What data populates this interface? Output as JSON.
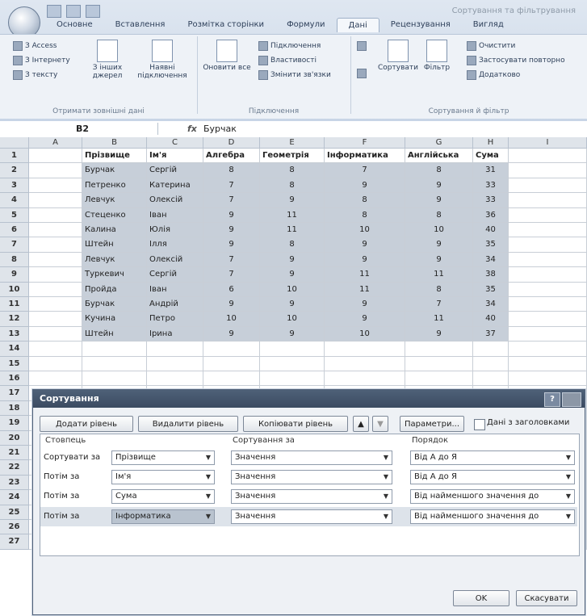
{
  "ribbon": {
    "window_title": "Сортування та фільтрування",
    "tabs": [
      "Основне",
      "Вставлення",
      "Розмітка сторінки",
      "Формули",
      "Дані",
      "Рецензування",
      "Вигляд"
    ],
    "active_tab": 4,
    "ext_data": [
      "З Access",
      "З Інтернету",
      "З тексту"
    ],
    "ext_other": "З інших джерел",
    "existing_conn": "Наявні підключення",
    "ext_group": "Отримати зовнішні дані",
    "refresh": "Оновити все",
    "conn_items": [
      "Підключення",
      "Властивості",
      "Змінити зв'язки"
    ],
    "conn_group": "Підключення",
    "sort_label": "Сортувати",
    "filter_label": "Фільтр",
    "filter_items": [
      "Очистити",
      "Застосувати повторно",
      "Додатково"
    ],
    "sort_group": "Сортування й фільтр"
  },
  "formula_bar": {
    "cell": "B2",
    "fx": "fx",
    "value": "Бурчак"
  },
  "sheet": {
    "columns": [
      "A",
      "B",
      "C",
      "D",
      "E",
      "F",
      "G",
      "H",
      "I"
    ],
    "header_row": [
      "Прізвище",
      "Ім'я",
      "Алгебра",
      "Геометрія",
      "Інформатика",
      "Англійська",
      "Сума"
    ],
    "rows": [
      [
        "Бурчак",
        "Сергій",
        "8",
        "8",
        "7",
        "8",
        "31"
      ],
      [
        "Петренко",
        "Катерина",
        "7",
        "8",
        "9",
        "9",
        "33"
      ],
      [
        "Левчук",
        "Олексій",
        "7",
        "9",
        "8",
        "9",
        "33"
      ],
      [
        "Стеценко",
        "Іван",
        "9",
        "11",
        "8",
        "8",
        "36"
      ],
      [
        "Калина",
        "Юлія",
        "9",
        "11",
        "10",
        "10",
        "40"
      ],
      [
        "Штейн",
        "Ілля",
        "9",
        "8",
        "9",
        "9",
        "35"
      ],
      [
        "Левчук",
        "Олексій",
        "7",
        "9",
        "9",
        "9",
        "34"
      ],
      [
        "Туркевич",
        "Сергій",
        "7",
        "9",
        "11",
        "11",
        "38"
      ],
      [
        "Пройда",
        "Іван",
        "6",
        "10",
        "11",
        "8",
        "35"
      ],
      [
        "Бурчак",
        "Андрій",
        "9",
        "9",
        "9",
        "7",
        "34"
      ],
      [
        "Кучина",
        "Петро",
        "10",
        "10",
        "9",
        "11",
        "40"
      ],
      [
        "Штейн",
        "Ірина",
        "9",
        "9",
        "10",
        "9",
        "37"
      ]
    ],
    "row_numbers": [
      "1",
      "2",
      "3",
      "4",
      "5",
      "6",
      "7",
      "8",
      "9",
      "10",
      "11",
      "12",
      "13",
      "14",
      "15",
      "16",
      "17",
      "18",
      "19",
      "20",
      "21",
      "22",
      "23",
      "24",
      "25",
      "26",
      "27"
    ]
  },
  "dialog": {
    "title": "Сортування",
    "help": "?",
    "add_level": "Додати рівень",
    "delete_level": "Видалити рівень",
    "copy_level": "Копіювати рівень",
    "params": "Параметри...",
    "headers_checkbox": "Дані з заголовками",
    "col_header": "Стовпець",
    "sorton_header": "Сортування за",
    "order_header": "Порядок",
    "levels": [
      {
        "label": "Сортувати за",
        "column": "Прізвище",
        "sort_on": "Значення",
        "order": "Від А до Я"
      },
      {
        "label": "Потім за",
        "column": "Ім'я",
        "sort_on": "Значення",
        "order": "Від А до Я"
      },
      {
        "label": "Потім за",
        "column": "Сума",
        "sort_on": "Значення",
        "order": "Від найменшого значення до найбільшого"
      },
      {
        "label": "Потім за",
        "column": "Інформатика",
        "sort_on": "Значення",
        "order": "Від найменшого значення до найбільшого"
      }
    ],
    "ok": "OK",
    "cancel": "Скасувати"
  }
}
